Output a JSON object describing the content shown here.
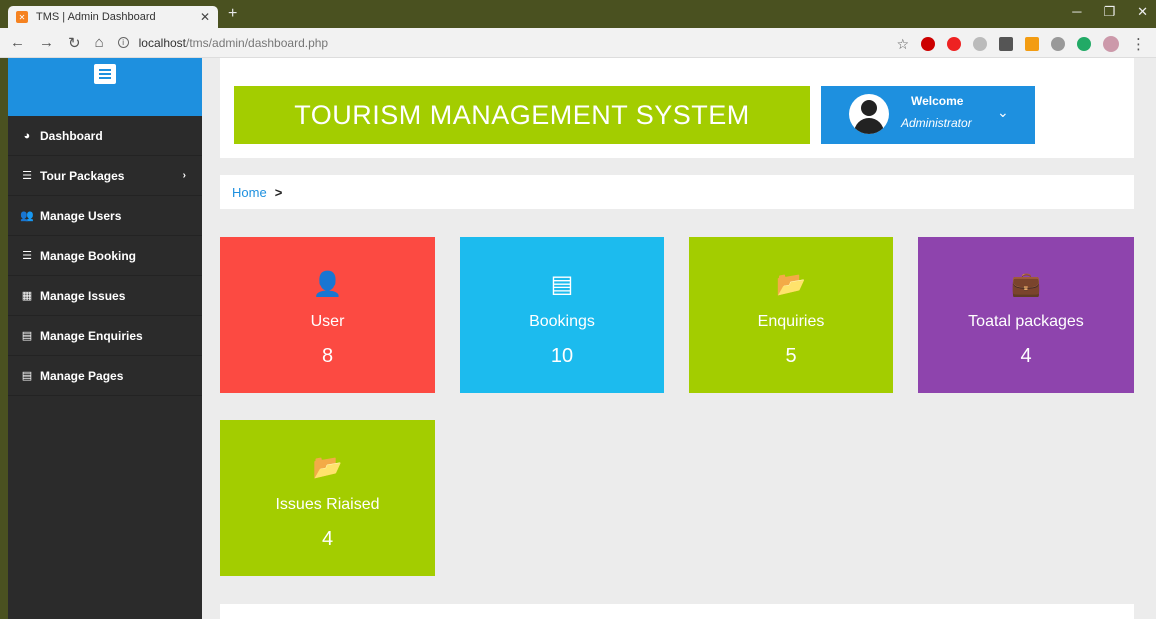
{
  "browser": {
    "tab_title": "TMS | Admin Dashboard",
    "url_host": "localhost",
    "url_path": "/tms/admin/dashboard.php"
  },
  "sidebar": {
    "items": [
      {
        "label": "Dashboard",
        "icon": "dashboard-icon"
      },
      {
        "label": "Tour Packages",
        "icon": "list-icon",
        "has_submenu": true
      },
      {
        "label": "Manage Users",
        "icon": "users-icon"
      },
      {
        "label": "Manage Booking",
        "icon": "list-icon"
      },
      {
        "label": "Manage Issues",
        "icon": "table-icon"
      },
      {
        "label": "Manage Enquiries",
        "icon": "file-icon"
      },
      {
        "label": "Manage Pages",
        "icon": "file-icon"
      }
    ]
  },
  "header": {
    "title": "TOURISM MANAGEMENT SYSTEM",
    "welcome": "Welcome",
    "role": "Administrator"
  },
  "breadcrumb": {
    "home": "Home"
  },
  "stats": [
    {
      "label": "User",
      "value": "8",
      "color": "#fc4a42",
      "icon": "user-icon"
    },
    {
      "label": "Bookings",
      "value": "10",
      "color": "#1cbbee",
      "icon": "list-alt-icon"
    },
    {
      "label": "Enquiries",
      "value": "5",
      "color": "#a3cd00",
      "icon": "folder-open-icon"
    },
    {
      "label": "Toatal packages",
      "value": "4",
      "color": "#8e44ad",
      "icon": "briefcase-icon"
    },
    {
      "label": "Issues Riaised",
      "value": "4",
      "color": "#a3cd00",
      "icon": "folder-open-icon"
    }
  ]
}
